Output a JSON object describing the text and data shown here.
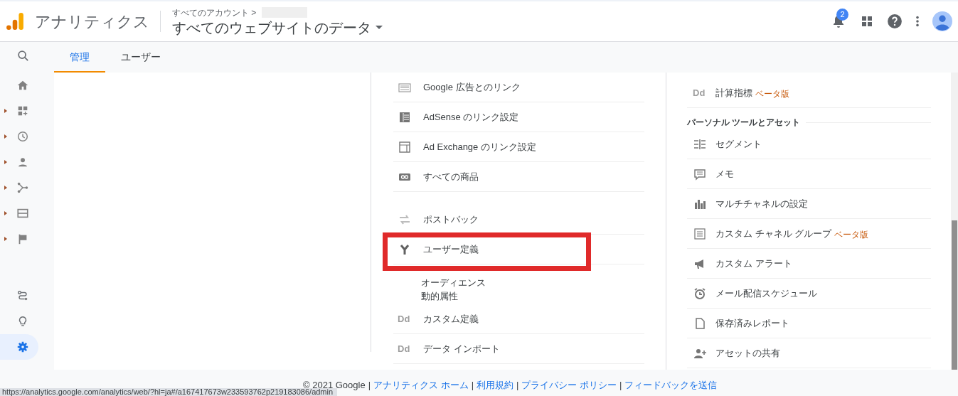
{
  "header": {
    "app_name": "アナリティクス",
    "breadcrumb": "すべてのアカウント >",
    "property": "すべてのウェブサイトのデータ",
    "notification_count": "2"
  },
  "sidebar": {
    "top_items": [
      {
        "expandable": false,
        "selected": false
      },
      {
        "expandable": false,
        "selected": false
      },
      {
        "expandable": true,
        "selected": false
      },
      {
        "expandable": true,
        "selected": false
      },
      {
        "expandable": true,
        "selected": false
      },
      {
        "expandable": true,
        "selected": false
      },
      {
        "expandable": true,
        "selected": false
      },
      {
        "expandable": true,
        "selected": false
      }
    ],
    "bottom_items": [
      {
        "selected": false
      },
      {
        "selected": false
      },
      {
        "selected": true
      }
    ]
  },
  "tabs": [
    {
      "label": "管理",
      "selected": true
    },
    {
      "label": "ユーザー",
      "selected": false
    }
  ],
  "middle_sections": [
    {
      "items": [
        {
          "label": "Google 広告とのリンク"
        },
        {
          "label": "AdSense のリンク設定"
        },
        {
          "label": "Ad Exchange のリンク設定"
        },
        {
          "label": "すべての商品"
        }
      ]
    },
    {
      "items": [
        {
          "label": "ポストバック"
        },
        {
          "label": "ユーザー定義",
          "children": [
            {
              "label": "オーディエンス"
            },
            {
              "label": "動的属性"
            }
          ]
        },
        {
          "icon_text": "Dd",
          "label": "カスタム定義"
        },
        {
          "icon_text": "Dd",
          "label": "データ インポート"
        }
      ]
    }
  ],
  "right_column": {
    "items": [
      {
        "kind": "item",
        "icon_text": "Dd",
        "label": "計算指標",
        "badge": "ベータ版"
      },
      {
        "kind": "heading",
        "label": "パーソナル ツールとアセット"
      },
      {
        "kind": "item",
        "label": "セグメント"
      },
      {
        "kind": "item",
        "label": "メモ"
      },
      {
        "kind": "item",
        "label": "マルチチャネルの設定"
      },
      {
        "kind": "item",
        "label": "カスタム チャネル グループ",
        "badge": "ベータ版"
      },
      {
        "kind": "item",
        "label": "カスタム アラート"
      },
      {
        "kind": "item",
        "label": "メール配信スケジュール"
      },
      {
        "kind": "item",
        "label": "保存済みレポート"
      },
      {
        "kind": "item",
        "label": "アセットの共有"
      }
    ]
  },
  "footer": {
    "copyright": "© 2021 Google",
    "separator": "|",
    "links": [
      "アナリティクス ホーム",
      "利用規約",
      "プライバシー ポリシー",
      "フィードバックを送信"
    ]
  },
  "status_url": "https://analytics.google.com/analytics/web/?hl=ja#/a167417673w233593762p219183086/admin"
}
